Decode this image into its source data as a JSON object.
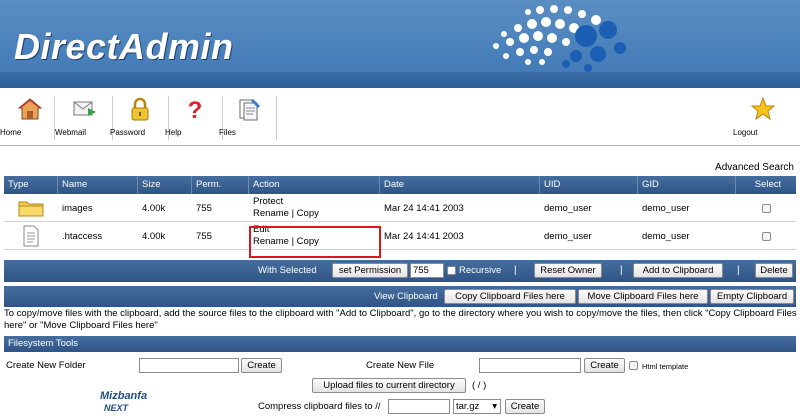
{
  "brand": "DirectAdmin",
  "toolbar": [
    {
      "label": "Home",
      "icon": "home-icon"
    },
    {
      "label": "Webmail",
      "icon": "webmail-icon"
    },
    {
      "label": "Password",
      "icon": "lock-icon"
    },
    {
      "label": "Help",
      "icon": "help-icon"
    },
    {
      "label": "Files",
      "icon": "files-icon"
    },
    {
      "label": "Logout",
      "icon": "star-icon"
    }
  ],
  "advanced_search": "Advanced Search",
  "table": {
    "headers": [
      "Type",
      "Name",
      "Size",
      "Perm.",
      "Action",
      "Date",
      "UID",
      "GID",
      "Select"
    ],
    "rows": [
      {
        "type_icon": "folder-icon",
        "name": "images",
        "size": "4.00k",
        "perm": "755",
        "action_top": "Protect",
        "action_rename": "Rename",
        "action_sep": "|",
        "action_copy": "Copy",
        "date": "Mar 24 14:41 2003",
        "uid": "demo_user",
        "gid": "demo_user"
      },
      {
        "type_icon": "file-icon",
        "name": ".htaccess",
        "size": "4.00k",
        "perm": "755",
        "action_top": "Edit",
        "action_rename": "Rename",
        "action_sep": "|",
        "action_copy": "Copy",
        "date": "Mar 24 14:41 2003",
        "uid": "demo_user",
        "gid": "demo_user"
      }
    ]
  },
  "with_selected": {
    "label": "With Selected",
    "set_permission": "set Permission",
    "perm_value": "755",
    "recursive": "Recursive",
    "reset_owner": "Reset Owner",
    "add_to_clipboard": "Add to Clipboard",
    "delete": "Delete",
    "sep": "|"
  },
  "clipboard": {
    "label": "View Clipboard",
    "copy_here": "Copy Clipboard Files here",
    "move_here": "Move Clipboard Files here",
    "empty": "Empty Clipboard"
  },
  "note": "To copy/move files with the clipboard, add the source files to the clipboard with \"Add to Clipboard\", go to the directory where you wish to copy/move the files, then click \"Copy Clipboard Files here\" or \"Move Clipboard Files here\"",
  "fs_tools": {
    "title": "Filesystem Tools",
    "create_folder_label": "Create New Folder",
    "create_folder_button": "Create",
    "create_file_label": "Create New File",
    "create_file_button": "Create",
    "html_template": "Html template",
    "upload_button": "Upload files to current directory",
    "upload_path": "( / )",
    "compress_label": "Compress clipboard files to //",
    "compress_ext": "tar.gz",
    "compress_button": "Create"
  },
  "watermark": {
    "line1": "Mizbanfa",
    "line2": "NEXT"
  },
  "colors": {
    "header": "#3f77b5",
    "bar": "#2e5585",
    "highlight": "#e0141e"
  }
}
